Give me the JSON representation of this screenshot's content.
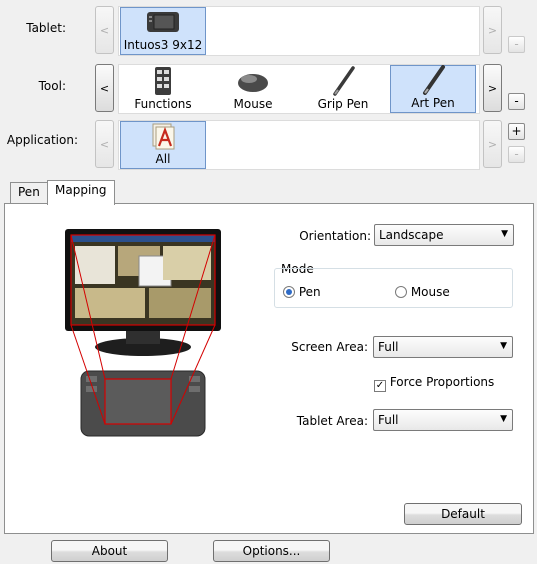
{
  "tablet_row": {
    "label": "Tablet:",
    "items": [
      {
        "label": "Intuos3 9x12",
        "icon": "tablet-icon",
        "selected": true
      }
    ]
  },
  "tool_row": {
    "label": "Tool:",
    "items": [
      {
        "label": "Functions",
        "icon": "functions-icon",
        "selected": false
      },
      {
        "label": "Mouse",
        "icon": "mouse-icon",
        "selected": false
      },
      {
        "label": "Grip Pen",
        "icon": "grip-pen-icon",
        "selected": false
      },
      {
        "label": "Art Pen",
        "icon": "art-pen-icon",
        "selected": true
      }
    ]
  },
  "application_row": {
    "label": "Application:",
    "items": [
      {
        "label": "All",
        "icon": "all-applications-icon",
        "selected": true
      }
    ]
  },
  "buttons": {
    "plus": "+",
    "minus": "-",
    "left": "<",
    "right": ">"
  },
  "tabs": [
    {
      "label": "Pen"
    },
    {
      "label": "Mapping",
      "active": true
    }
  ],
  "mapping": {
    "orientation_label": "Orientation:",
    "orientation_value": "Landscape",
    "mode_label": "Mode",
    "mode_pen": "Pen",
    "mode_mouse": "Mouse",
    "mode_selected": "Pen",
    "screen_area_label": "Screen Area:",
    "screen_area_value": "Full",
    "force_proportions_label": "Force Proportions",
    "force_proportions_checked": true,
    "tablet_area_label": "Tablet Area:",
    "tablet_area_value": "Full",
    "default_button": "Default"
  },
  "footer": {
    "about": "About",
    "options": "Options..."
  },
  "colors": {
    "selection": "#cfe2fb",
    "mapping_lines": "#d40000"
  }
}
